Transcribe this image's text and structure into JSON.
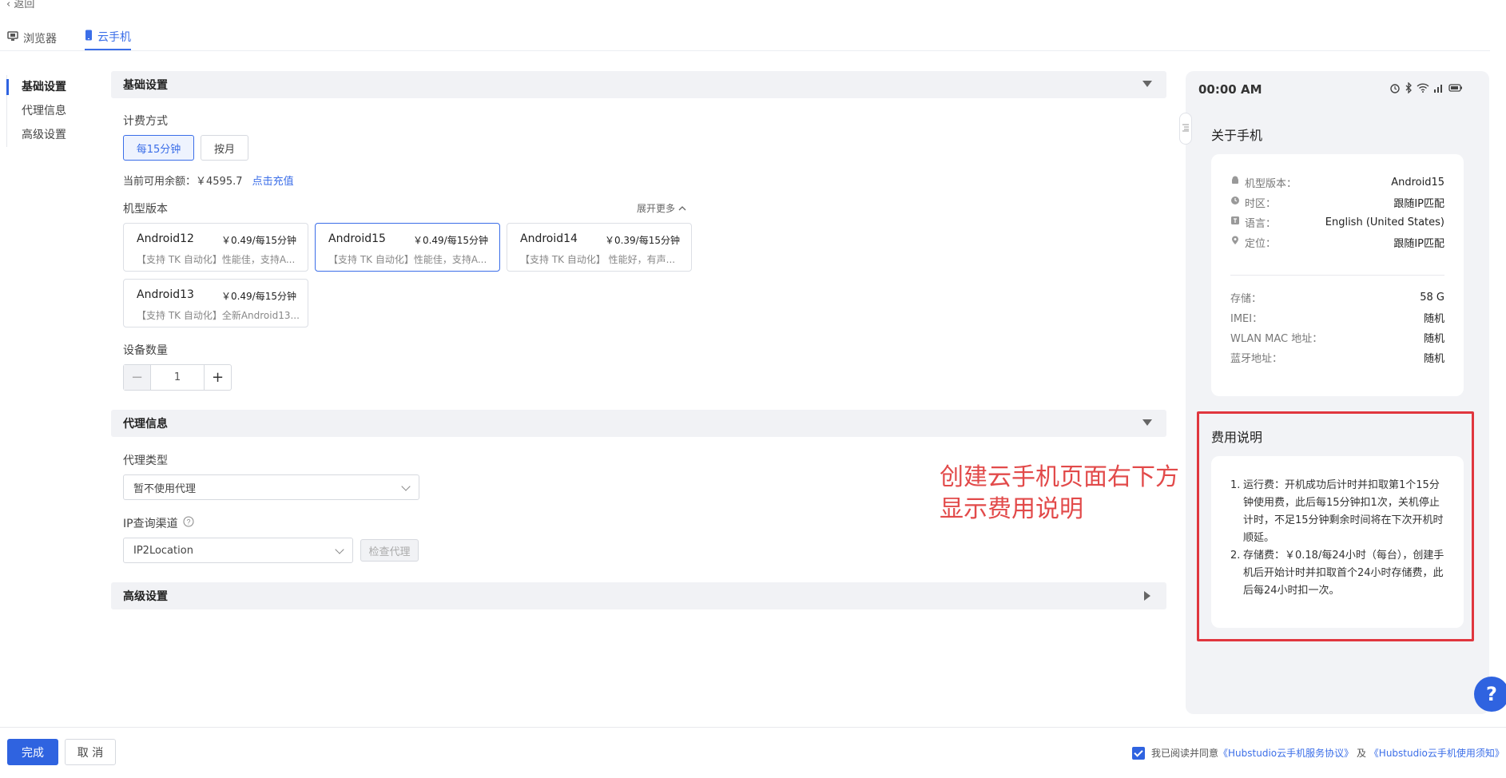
{
  "back_label": "‹ 返回",
  "tabs": [
    {
      "label": "浏览器",
      "active": false
    },
    {
      "label": "云手机",
      "active": true
    }
  ],
  "left_nav": [
    {
      "label": "基础设置",
      "active": true
    },
    {
      "label": "代理信息",
      "active": false
    },
    {
      "label": "高级设置",
      "active": false
    }
  ],
  "basic": {
    "section_title": "基础设置",
    "billing_label": "计费方式",
    "billing_options": [
      "每15分钟",
      "按月"
    ],
    "billing_selected": "每15分钟",
    "balance_label": "当前可用余额：￥4595.7",
    "recharge_link": "点击充值",
    "model_label": "机型版本",
    "expand_more": "展开更多",
    "models": [
      {
        "name": "Android12",
        "price": "￥0.49/每15分钟",
        "desc": "【支持 TK 自动化】性能佳，支持A...",
        "selected": false
      },
      {
        "name": "Android15",
        "price": "￥0.49/每15分钟",
        "desc": "【支持 TK 自动化】性能佳，支持A...",
        "selected": true
      },
      {
        "name": "Android14",
        "price": "￥0.39/每15分钟",
        "desc": "【支持 TK 自动化】 性能好，有声...",
        "selected": false
      },
      {
        "name": "Android13",
        "price": "￥0.49/每15分钟",
        "desc": "【支持 TK 自动化】全新Android13...",
        "selected": false
      }
    ],
    "device_count_label": "设备数量",
    "device_count": "1"
  },
  "proxy": {
    "section_title": "代理信息",
    "type_label": "代理类型",
    "type_value": "暂不使用代理",
    "ip_channel_label": "IP查询渠道",
    "ip_channel_value": "IP2Location",
    "check_button": "检查代理"
  },
  "advanced": {
    "section_title": "高级设置"
  },
  "annotation": {
    "line1": "创建云手机页面右下方",
    "line2": "显示费用说明"
  },
  "phone": {
    "time": "00:00 AM",
    "about_title": "关于手机",
    "info_rows": [
      {
        "icon": "android-icon",
        "key": "机型版本：",
        "value": "Android15"
      },
      {
        "icon": "timezone-icon",
        "key": "时区：",
        "value": "跟随IP匹配"
      },
      {
        "icon": "language-icon",
        "key": "语言：",
        "value": "English (United States)"
      },
      {
        "icon": "location-icon",
        "key": "定位：",
        "value": "跟随IP匹配"
      }
    ],
    "spec_rows": [
      {
        "key": "存储：",
        "value": "58 G"
      },
      {
        "key": "IMEI：",
        "value": "随机"
      },
      {
        "key": "WLAN MAC 地址：",
        "value": "随机"
      },
      {
        "key": "蓝牙地址：",
        "value": "随机"
      }
    ],
    "fee_title": "费用说明",
    "fee_items": [
      {
        "num": "1.",
        "text": "运行费：开机成功后计时并扣取第1个15分钟使用费，此后每15分钟扣1次，关机停止计时，不足15分钟剩余时间将在下次开机时顺延。"
      },
      {
        "num": "2.",
        "text": "存储费：￥0.18/每24小时（每台），创建手机后开始计时并扣取首个24小时存储费，此后每24小时扣一次。"
      }
    ]
  },
  "help_label": "?",
  "footer": {
    "done": "完成",
    "cancel": "取 消",
    "agree_prefix": "我已阅读并同意",
    "agree_link1": "《Hubstudio云手机服务协议》",
    "agree_and": "及",
    "agree_link2": "《Hubstudio云手机使用须知》"
  },
  "colors": {
    "primary": "#2f63e0",
    "annotation": "#e24a4a",
    "highlight_border": "#e0363e"
  }
}
